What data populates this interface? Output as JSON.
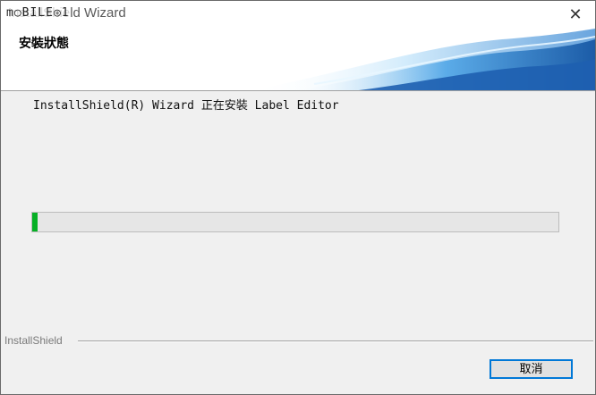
{
  "window": {
    "title": "InstallShield Wizard",
    "watermark": "MOBILE01",
    "close_icon": "close-icon"
  },
  "banner": {
    "heading": "安裝狀態",
    "colors": {
      "wave_dark": "#1a5fb4",
      "wave_light": "#7ec3f0"
    }
  },
  "body": {
    "status_text": "InstallShield(R) Wizard 正在安裝 Label Editor",
    "progress_fraction": 0.01
  },
  "footer": {
    "brand": "InstallShield",
    "cancel_label": "取消"
  },
  "colors": {
    "progress_fill": "#06b025",
    "button_border": "#0078d7"
  }
}
